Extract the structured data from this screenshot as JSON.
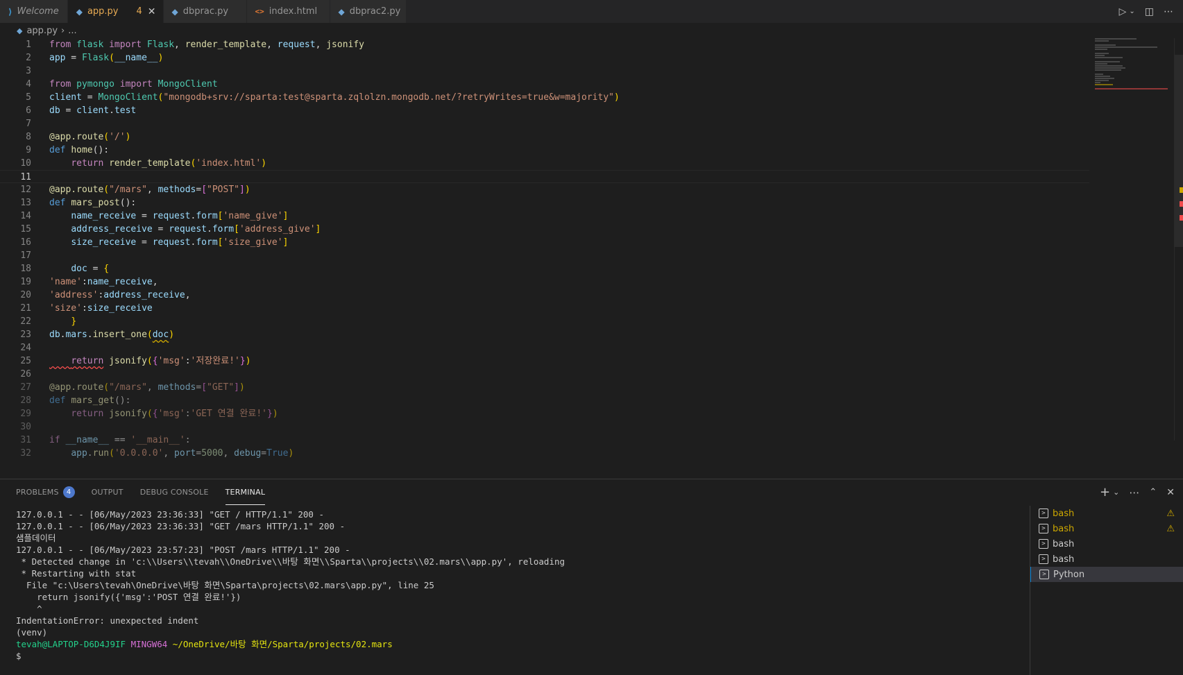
{
  "tabs": [
    {
      "label": "Welcome",
      "icon": "vscode-logo-icon",
      "active": false
    },
    {
      "label": "app.py",
      "icon": "python-file-icon",
      "active": true,
      "problems": "4"
    },
    {
      "label": "dbprac.py",
      "icon": "python-file-icon",
      "active": false
    },
    {
      "label": "index.html",
      "icon": "html-file-icon",
      "active": false
    },
    {
      "label": "dbprac2.py",
      "icon": "python-file-icon",
      "active": false
    }
  ],
  "tab_actions": [
    "run-icon",
    "chevron-down-icon",
    "split-editor-icon",
    "more-icon"
  ],
  "breadcrumb": {
    "file": "app.py",
    "rest": "..."
  },
  "editor": {
    "current_line": 11,
    "lines": [
      {
        "n": "1"
      },
      {
        "n": "2"
      },
      {
        "n": "3"
      },
      {
        "n": "4"
      },
      {
        "n": "5"
      },
      {
        "n": "6"
      },
      {
        "n": "7"
      },
      {
        "n": "8"
      },
      {
        "n": "9"
      },
      {
        "n": "10"
      },
      {
        "n": "11"
      },
      {
        "n": "12"
      },
      {
        "n": "13"
      },
      {
        "n": "14"
      },
      {
        "n": "15"
      },
      {
        "n": "16"
      },
      {
        "n": "17"
      },
      {
        "n": "18"
      },
      {
        "n": "19"
      },
      {
        "n": "20"
      },
      {
        "n": "21"
      },
      {
        "n": "22"
      },
      {
        "n": "23"
      },
      {
        "n": "24"
      },
      {
        "n": "25"
      },
      {
        "n": "26"
      },
      {
        "n": "27"
      },
      {
        "n": "28"
      },
      {
        "n": "29"
      },
      {
        "n": "30"
      },
      {
        "n": "31"
      },
      {
        "n": "32"
      }
    ],
    "code": {
      "l1": {
        "a": "from",
        "b": "flask",
        "c": "import",
        "d": "Flask",
        "e": ", ",
        "f": "render_template",
        "g": ", ",
        "h": "request",
        "i": ", ",
        "j": "jsonify"
      },
      "l2": {
        "a": "app",
        "b": " = ",
        "c": "Flask",
        "d": "(",
        "e": "__name__",
        "f": ")"
      },
      "l4": {
        "a": "from",
        "b": "pymongo",
        "c": "import",
        "d": "MongoClient"
      },
      "l5": {
        "a": "client",
        "b": " = ",
        "c": "MongoClient",
        "d": "(",
        "e": "\"mongodb+srv://sparta:test@sparta.zqlolzn.mongodb.net/?retryWrites=true&w=majority\"",
        "f": ")"
      },
      "l6": {
        "a": "db",
        "b": " = ",
        "c": "client",
        "d": ".",
        "e": "test"
      },
      "l8": {
        "a": "@app.route",
        "b": "(",
        "c": "'/'",
        "d": ")"
      },
      "l9": {
        "a": "def",
        "b": "home",
        "c": "():"
      },
      "l10": {
        "a": "return",
        "b": "render_template",
        "c": "(",
        "d": "'index.html'",
        "e": ")"
      },
      "l12": {
        "a": "@app.route",
        "b": "(",
        "c": "\"/mars\"",
        "d": ", ",
        "e": "methods",
        "f": "=",
        "g": "[",
        "h": "\"POST\"",
        "i": "]",
        "j": ")"
      },
      "l13": {
        "a": "def",
        "b": "mars_post",
        "c": "():"
      },
      "l14": {
        "a": "name_receive",
        "b": " = ",
        "c": "request",
        "d": ".",
        "e": "form",
        "f": "[",
        "g": "'name_give'",
        "h": "]"
      },
      "l15": {
        "a": "address_receive",
        "b": " = ",
        "c": "request",
        "d": ".",
        "e": "form",
        "f": "[",
        "g": "'address_give'",
        "h": "]"
      },
      "l16": {
        "a": "size_receive",
        "b": " = ",
        "c": "request",
        "d": ".",
        "e": "form",
        "f": "[",
        "g": "'size_give'",
        "h": "]"
      },
      "l18": {
        "a": "doc",
        "b": " = ",
        "c": "{"
      },
      "l19": {
        "a": "'name'",
        "b": ":",
        "c": "name_receive",
        "d": ","
      },
      "l20": {
        "a": "'address'",
        "b": ":",
        "c": "address_receive",
        "d": ","
      },
      "l21": {
        "a": "'size'",
        "b": ":",
        "c": "size_receive"
      },
      "l22": {
        "a": "}"
      },
      "l23": {
        "a": "db",
        "b": ".",
        "c": "mars",
        "d": ".",
        "e": "insert_one",
        "f": "(",
        "g": "doc",
        "h": ")"
      },
      "l25": {
        "a": "return",
        "b": "jsonify",
        "c": "(",
        "d": "{",
        "e": "'msg'",
        "f": ":",
        "g": "'저장완료!'",
        "h": "}",
        "i": ")"
      },
      "l27": {
        "a": "@app.route",
        "b": "(",
        "c": "\"/mars\"",
        "d": ", ",
        "e": "methods",
        "f": "=",
        "g": "[",
        "h": "\"GET\"",
        "i": "]",
        "j": ")"
      },
      "l28": {
        "a": "def",
        "b": "mars_get",
        "c": "():"
      },
      "l29": {
        "a": "return",
        "b": "jsonify",
        "c": "(",
        "d": "{",
        "e": "'msg'",
        "f": ":",
        "g": "'GET 연결 완료!'",
        "h": "}",
        "i": ")"
      },
      "l31": {
        "a": "if",
        "b": "__name__",
        "c": " == ",
        "d": "'__main__'",
        "e": ":"
      },
      "l32": {
        "a": "app",
        "b": ".",
        "c": "run",
        "d": "(",
        "e": "'0.0.0.0'",
        "f": ", ",
        "g": "port",
        "h": "=",
        "i": "5000",
        "j": ", ",
        "k": "debug",
        "l": "=",
        "m": "True",
        "n": ")"
      }
    }
  },
  "panel": {
    "tabs": [
      {
        "label": "PROBLEMS",
        "badge": "4",
        "active": false
      },
      {
        "label": "OUTPUT",
        "active": false
      },
      {
        "label": "DEBUG CONSOLE",
        "active": false
      },
      {
        "label": "TERMINAL",
        "active": true
      }
    ],
    "actions": [
      "add-terminal-icon",
      "chevron-down-icon",
      "more-icon",
      "maximize-panel-icon",
      "close-panel-icon"
    ],
    "terminal_lines": [
      "127.0.0.1 - - [06/May/2023 23:36:33] \"GET / HTTP/1.1\" 200 -",
      "127.0.0.1 - - [06/May/2023 23:36:33] \"GET /mars HTTP/1.1\" 200 -",
      "샘플데이터",
      "127.0.0.1 - - [06/May/2023 23:57:23] \"POST /mars HTTP/1.1\" 200 -",
      " * Detected change in 'c:\\\\Users\\\\tevah\\\\OneDrive\\\\바탕 화면\\\\Sparta\\\\projects\\\\02.mars\\\\app.py', reloading",
      " * Restarting with stat",
      "  File \"c:\\Users\\tevah\\OneDrive\\바탕 화면\\Sparta\\projects\\02.mars\\app.py\", line 25",
      "    return jsonify({'msg':'POST 연결 완료!'})",
      "    ^",
      "IndentationError: unexpected indent",
      "(venv)"
    ],
    "prompt": {
      "user": "tevah@LAPTOP-D6D4J9IF",
      "shell": "MINGW64",
      "path": "~/OneDrive/바탕 화면/Sparta/projects/02.mars",
      "symbol": "$"
    },
    "terminals": [
      {
        "label": "bash",
        "warning": true
      },
      {
        "label": "bash",
        "warning": true
      },
      {
        "label": "bash",
        "warning": false
      },
      {
        "label": "bash",
        "warning": false
      },
      {
        "label": "Python",
        "warning": false,
        "active": true
      }
    ]
  },
  "colors": {
    "accent": "#007fd4",
    "warning": "#cca700",
    "error": "#f14c4c",
    "modified_tab": "#e8ab53"
  }
}
